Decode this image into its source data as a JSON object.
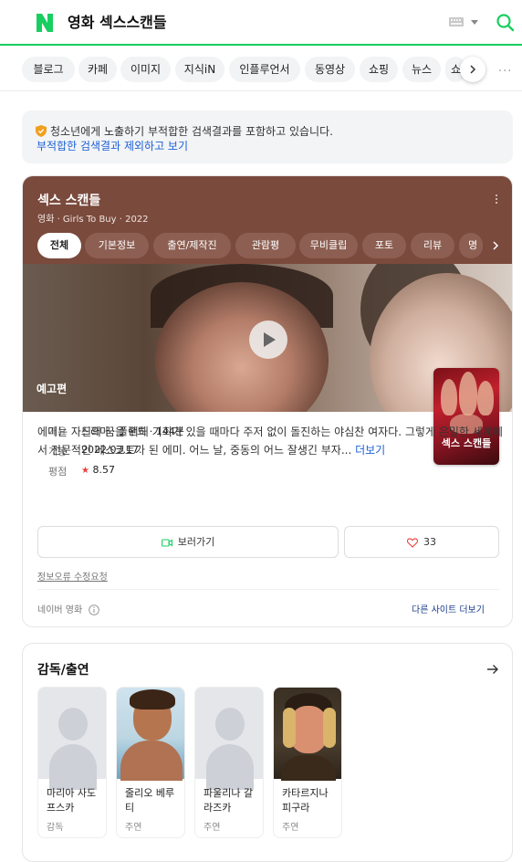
{
  "header": {
    "query": "영화 섹스스캔들"
  },
  "tabs": [
    "블로그",
    "카페",
    "이미지",
    "지식iN",
    "인플루언서",
    "동영상",
    "쇼핑",
    "뉴스",
    "쇼"
  ],
  "notice": {
    "line1": "청소년에게 노출하기 부적합한 검색결과를 포함하고 있습니다.",
    "line2": "부적합한 검색결과 제외하고 보기"
  },
  "movie": {
    "title": "섹스 스캔들",
    "meta": "영화 · Girls To Buy · 2022",
    "subtabs": [
      "전체",
      "기본정보",
      "출연/제작진",
      "관람평",
      "무비클립",
      "포토",
      "리뷰",
      "명"
    ],
    "trailer_label": "예고편",
    "poster_text": "섹스 스캔들",
    "info": [
      {
        "key": "개요",
        "value": "드라마 · 폴란드 · 144분"
      },
      {
        "key": "개봉",
        "value": "2022.03.17."
      },
      {
        "key": "평점",
        "value": "8.57"
      }
    ],
    "synopsis": "에미는 자신의 꿈을 위해 기회가 있을 때마다 주저 없이 돌진하는 야심찬 여자다. 그렇게 은밀한 세계에서 전문적인 에스코트가 된 에미. 어느 날, 중동의 어느 잘생긴 부자...",
    "more": "더보기",
    "watch": "보러가기",
    "likes": "33",
    "report": "정보오류 수정요청",
    "source": "네이버 영화",
    "other_sites": "다른 사이트 더보기"
  },
  "cast": {
    "title": "감독/출연",
    "people": [
      {
        "name": "마리아 사도프스카",
        "role": "감독",
        "photo": "placeholder"
      },
      {
        "name": "줄리오 베루티",
        "role": "주연",
        "photo": "man"
      },
      {
        "name": "파울리나 갈라즈카",
        "role": "주연",
        "photo": "placeholder"
      },
      {
        "name": "카타르지나 피구라",
        "role": "주연",
        "photo": "woman"
      }
    ]
  },
  "colors": {
    "brand_green": "#19ce60",
    "card_brown": "#7a4a3d",
    "link_blue": "#1a5fd6",
    "star_red": "#ee3d3d"
  }
}
